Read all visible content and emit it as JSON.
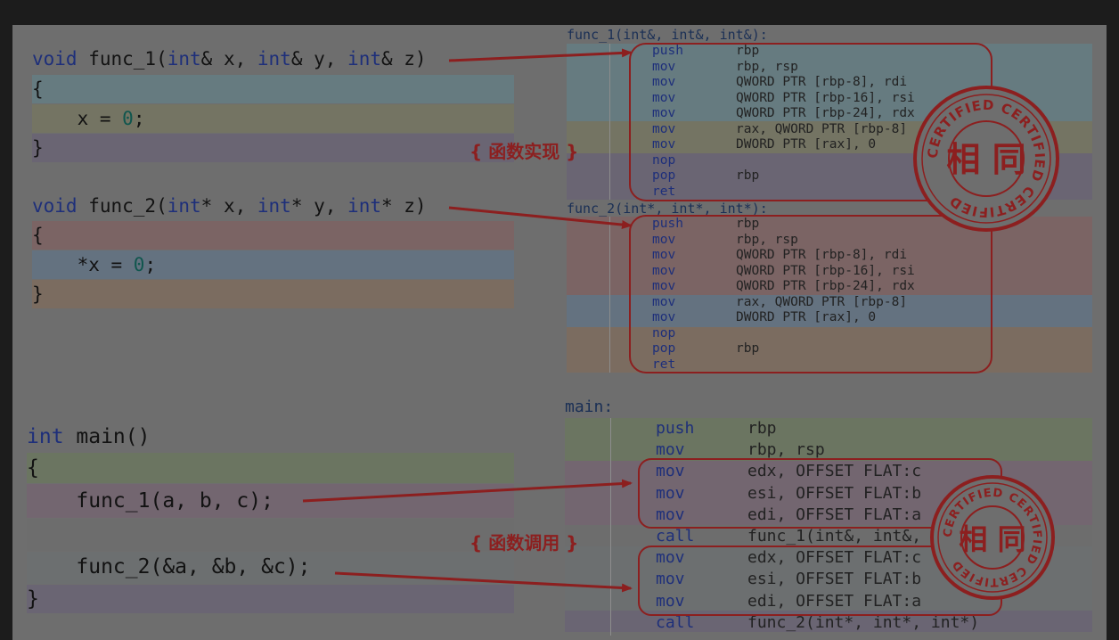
{
  "cpp": {
    "f1_sig": [
      "void",
      " func_1(",
      "int",
      "& x, ",
      "int",
      "& y, ",
      "int",
      "& z)"
    ],
    "f1_open": "{",
    "f1_body": [
      "    x = ",
      "0",
      ";"
    ],
    "f1_close": "}",
    "f2_sig": [
      "void",
      " func_2(",
      "int",
      "* x, ",
      "int",
      "* y, ",
      "int",
      "* z)"
    ],
    "f2_open": "{",
    "f2_body": [
      "    *x = ",
      "0",
      ";"
    ],
    "f2_close": "}",
    "main_sig": [
      "int",
      " main()"
    ],
    "main_open": "{",
    "main_call1": "    func_1(a, b, c);",
    "main_call2": "    func_2(&a, &b, &c);",
    "main_close": "}"
  },
  "asm": {
    "f1_title": "func_1(int&, int&, int&):",
    "f1_rows": [
      {
        "mn": "push",
        "op": "rbp"
      },
      {
        "mn": "mov",
        "op": "rbp, rsp"
      },
      {
        "mn": "mov",
        "op": "QWORD PTR [rbp-8], rdi"
      },
      {
        "mn": "mov",
        "op": "QWORD PTR [rbp-16], rsi"
      },
      {
        "mn": "mov",
        "op": "QWORD PTR [rbp-24], rdx"
      },
      {
        "mn": "mov",
        "op": "rax, QWORD PTR [rbp-8]"
      },
      {
        "mn": "mov",
        "op": "DWORD PTR [rax], 0"
      },
      {
        "mn": "nop",
        "op": ""
      },
      {
        "mn": "pop",
        "op": "rbp"
      },
      {
        "mn": "ret",
        "op": ""
      }
    ],
    "f2_title": "func_2(int*, int*, int*):",
    "f2_rows": [
      {
        "mn": "push",
        "op": "rbp"
      },
      {
        "mn": "mov",
        "op": "rbp, rsp"
      },
      {
        "mn": "mov",
        "op": "QWORD PTR [rbp-8], rdi"
      },
      {
        "mn": "mov",
        "op": "QWORD PTR [rbp-16], rsi"
      },
      {
        "mn": "mov",
        "op": "QWORD PTR [rbp-24], rdx"
      },
      {
        "mn": "mov",
        "op": "rax, QWORD PTR [rbp-8]"
      },
      {
        "mn": "mov",
        "op": "DWORD PTR [rax], 0"
      },
      {
        "mn": "nop",
        "op": ""
      },
      {
        "mn": "pop",
        "op": "rbp"
      },
      {
        "mn": "ret",
        "op": ""
      }
    ],
    "main_title": "main:",
    "main_rows": [
      {
        "mn": "push",
        "op": "rbp"
      },
      {
        "mn": "mov",
        "op": "rbp, rsp"
      },
      {
        "mn": "mov",
        "op": "edx, OFFSET FLAT:c"
      },
      {
        "mn": "mov",
        "op": "esi, OFFSET FLAT:b"
      },
      {
        "mn": "mov",
        "op": "edi, OFFSET FLAT:a"
      },
      {
        "mn": "call",
        "op": "func_1(int&, int&, int&)"
      },
      {
        "mn": "mov",
        "op": "edx, OFFSET FLAT:c"
      },
      {
        "mn": "mov",
        "op": "esi, OFFSET FLAT:b"
      },
      {
        "mn": "mov",
        "op": "edi, OFFSET FLAT:a"
      },
      {
        "mn": "call",
        "op": "func_2(int*, int*, int*)"
      }
    ]
  },
  "labels": {
    "impl": "{ 函数实现 }",
    "call": "{ 函数调用 }"
  },
  "stamps": {
    "ring_text": "CERTIFIED CERTIFIED CERTIFIED",
    "center": "相 同"
  },
  "colors": {
    "bg": "#6e6e6e",
    "accent_red": "#8c1f1f",
    "band_blue": "#667b80",
    "band_yellow": "#747463",
    "band_purple": "#6a6573",
    "band_red": "#7b6464",
    "band_steel": "#647280",
    "band_orange": "#7b6c60",
    "band_green": "#6b7561"
  }
}
